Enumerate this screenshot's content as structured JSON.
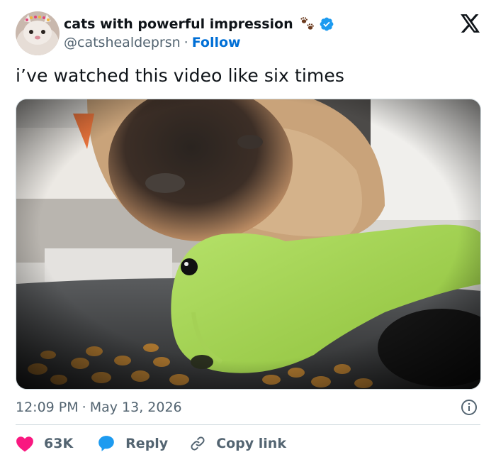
{
  "author": {
    "display_name": "cats with powerful impression",
    "handle": "@catshealdeprsn",
    "follow_label": "Follow",
    "separator": "·"
  },
  "tweet": {
    "text": "i’ve watched this video like six times"
  },
  "meta": {
    "time": "12:09 PM",
    "separator": "·",
    "date": "May 13, 2026"
  },
  "actions": {
    "like_count": "63K",
    "reply_label": "Reply",
    "copy_link_label": "Copy link"
  },
  "colors": {
    "like": "#f91880",
    "reply": "#1d9bf0",
    "verified": "#1d9bf0",
    "follow": "#006fd6"
  },
  "icons": [
    "paw-prints-icon",
    "verified-badge-icon",
    "x-logo-icon",
    "info-icon",
    "heart-icon",
    "reply-bubble-icon",
    "link-icon"
  ]
}
